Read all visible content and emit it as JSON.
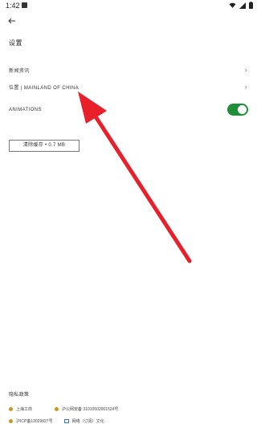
{
  "status_bar": {
    "time": "1:42",
    "icons": [
      "wifi-icon",
      "signal-icon",
      "battery-icon"
    ]
  },
  "page": {
    "title": "设置"
  },
  "settings": {
    "news": {
      "label": "新闻资讯"
    },
    "location": {
      "label": "位置 | MAINLAND OF CHINA"
    },
    "animations": {
      "label": "ANIMATIONS",
      "enabled": true
    },
    "clear_cache": {
      "label": "清除缓存 • 0.7 MB"
    }
  },
  "footer": {
    "privacy": "隐私政策",
    "icp_left": "上海工商",
    "icp_right": "沪公网安备 31010502001524号",
    "bottom_left": "沪ICP备12029927号",
    "bottom_right": "网络（订阅）文化"
  },
  "colors": {
    "toggle_on": "#1f8f3a",
    "annotation_arrow": "#e8202a"
  }
}
